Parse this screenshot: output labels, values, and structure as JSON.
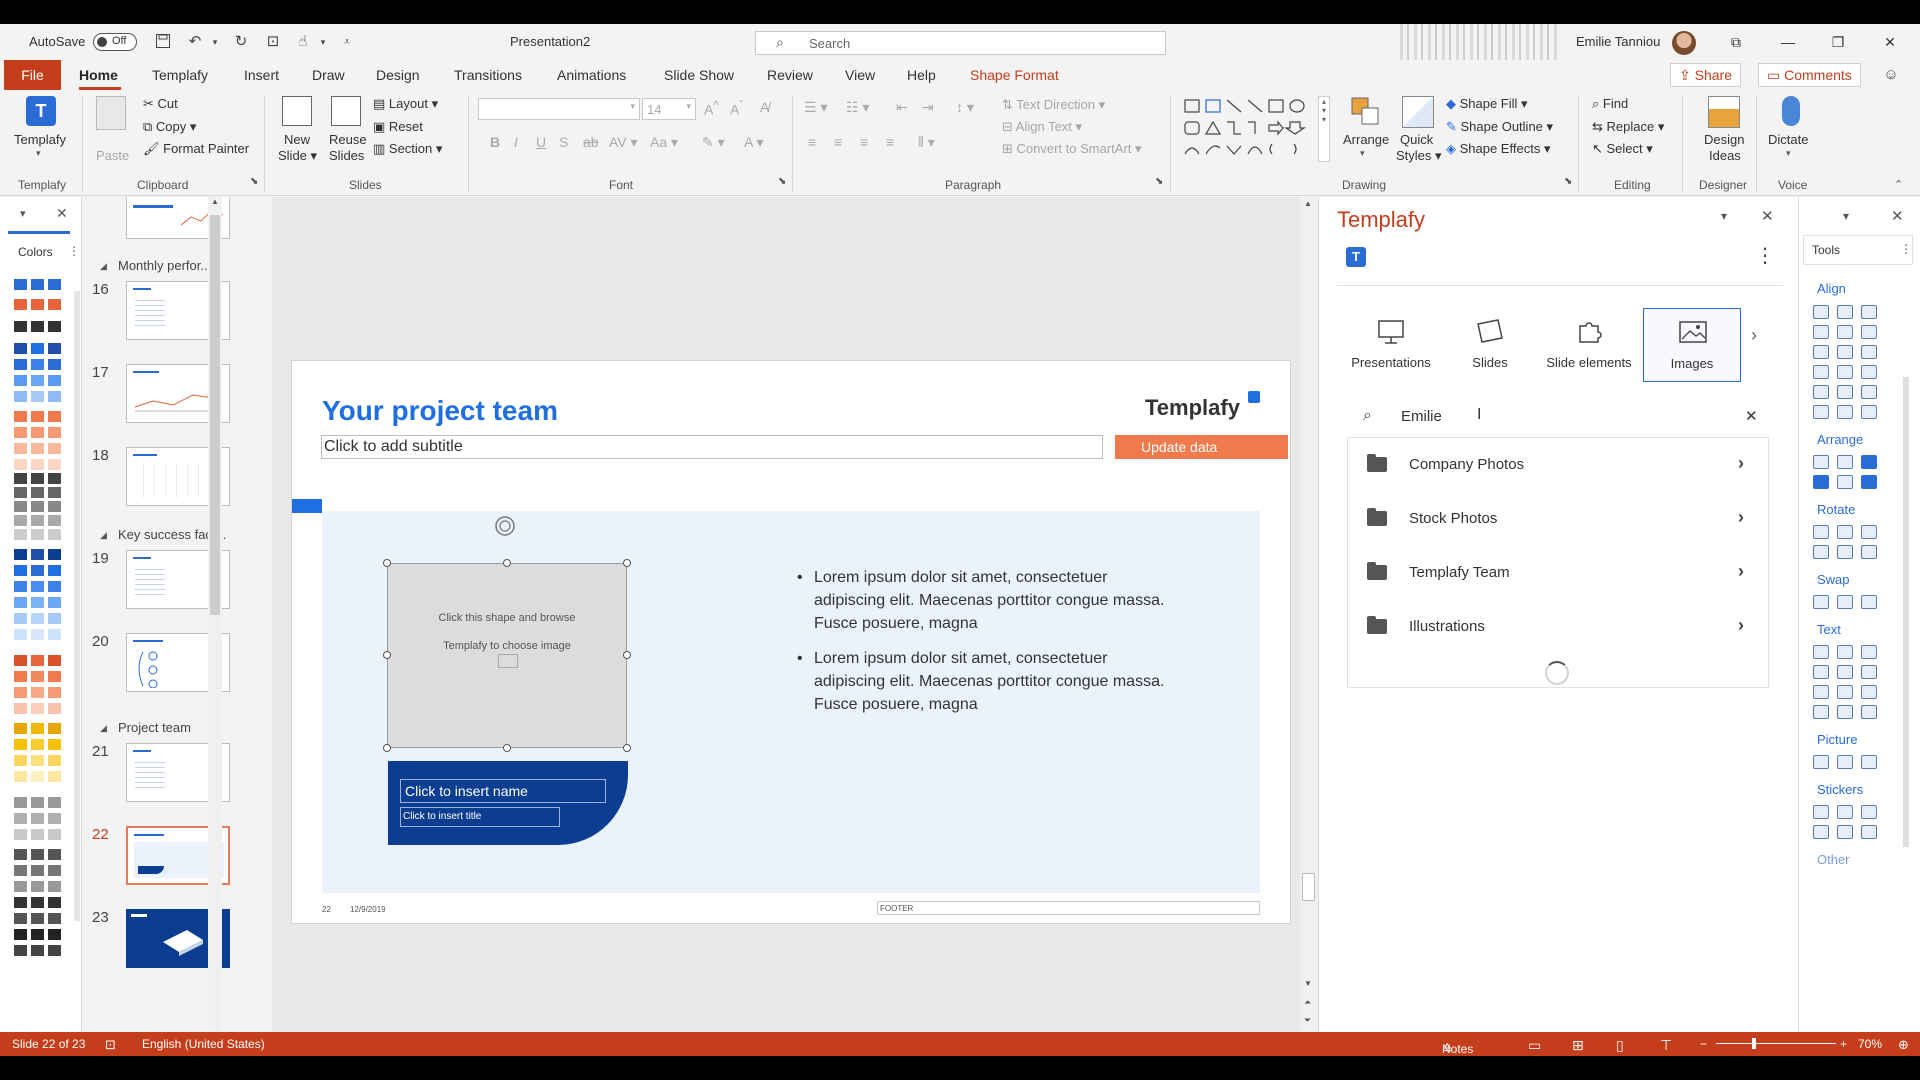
{
  "titlebar": {
    "autosave_label": "AutoSave",
    "autosave_state": "Off",
    "doc_title": "Presentation2",
    "search_placeholder": "Search",
    "user_name": "Emilie Tanniou"
  },
  "tabs": {
    "file": "File",
    "home": "Home",
    "templafy": "Templafy",
    "insert": "Insert",
    "draw": "Draw",
    "design": "Design",
    "transitions": "Transitions",
    "animations": "Animations",
    "slideshow": "Slide Show",
    "review": "Review",
    "view": "View",
    "help": "Help",
    "shape_format": "Shape Format",
    "share": "Share",
    "comments": "Comments"
  },
  "ribbon": {
    "templafy": {
      "button": "Templafy",
      "group": "Templafy"
    },
    "clipboard": {
      "paste": "Paste",
      "cut": "Cut",
      "copy": "Copy",
      "format_painter": "Format Painter",
      "group": "Clipboard"
    },
    "slides": {
      "new_slide": "New\nSlide",
      "new_slide_1": "New",
      "new_slide_2": "Slide",
      "reuse_1": "Reuse",
      "reuse_2": "Slides",
      "layout": "Layout",
      "reset": "Reset",
      "section": "Section",
      "group": "Slides"
    },
    "font": {
      "size": "14",
      "group": "Font"
    },
    "paragraph": {
      "text_direction": "Text Direction",
      "align_text": "Align Text",
      "smartart": "Convert to SmartArt",
      "group": "Paragraph"
    },
    "drawing": {
      "arrange": "Arrange",
      "quick_1": "Quick",
      "quick_2": "Styles",
      "shape_fill": "Shape Fill",
      "shape_outline": "Shape Outline",
      "shape_effects": "Shape Effects",
      "group": "Drawing"
    },
    "editing": {
      "find": "Find",
      "replace": "Replace",
      "select": "Select",
      "group": "Editing"
    },
    "designer": {
      "btn_1": "Design",
      "btn_2": "Ideas",
      "group": "Designer"
    },
    "voice": {
      "btn": "Dictate",
      "group": "Voice"
    }
  },
  "colorpane": {
    "title": "Colors"
  },
  "thumbnails": {
    "sections": [
      "Monthly perfor...",
      "Key success fact...",
      "Project team"
    ],
    "slides": [
      "16",
      "17",
      "18",
      "19",
      "20",
      "21",
      "22",
      "23"
    ],
    "selected": "22"
  },
  "slide": {
    "title": "Your project team",
    "subtitle": "Click to add subtitle",
    "update_button": "Update data",
    "logo": "Templafy",
    "placeholder_line1": "Click this shape and browse",
    "placeholder_line2": "Templafy to choose image",
    "name_placeholder": "Click to insert name",
    "title_placeholder": "Click to insert title",
    "bullets": [
      "Lorem ipsum dolor sit amet, consectetuer adipiscing elit. Maecenas porttitor congue massa. Fusce posuere, magna",
      "Lorem ipsum dolor sit amet, consectetuer adipiscing elit. Maecenas porttitor congue massa. Fusce posuere, magna"
    ],
    "bullet_lines": [
      [
        "Lorem ipsum dolor sit amet, consectetuer",
        "adipiscing elit. Maecenas porttitor congue massa.",
        "Fusce posuere, magna"
      ],
      [
        "Lorem ipsum dolor sit amet, consectetuer",
        "adipiscing elit. Maecenas porttitor congue massa.",
        "Fusce posuere, magna"
      ]
    ],
    "footer_num": "22",
    "footer_date": "12/9/2019",
    "footer_text": "FOOTER"
  },
  "templafy_pane": {
    "title": "Templafy",
    "nav": [
      "Presentations",
      "Slides",
      "Slide elements",
      "Images"
    ],
    "active_nav": "Images",
    "search_value": "Emilie",
    "folders": [
      "Company Photos",
      "Stock Photos",
      "Templafy Team",
      "Illustrations"
    ]
  },
  "tools_pane": {
    "title": "Tools",
    "sections": [
      "Align",
      "Arrange",
      "Rotate",
      "Swap",
      "Text",
      "Picture",
      "Stickers",
      "Other"
    ]
  },
  "statusbar": {
    "slide_info": "Slide 22 of 23",
    "language": "English (United States)",
    "notes": "Notes",
    "zoom": "70%"
  },
  "colors": {
    "accent": "#c43e1c",
    "brand_blue": "#1f6fe0",
    "slide_orange": "#f07a4c",
    "navy": "#0b3d91"
  }
}
